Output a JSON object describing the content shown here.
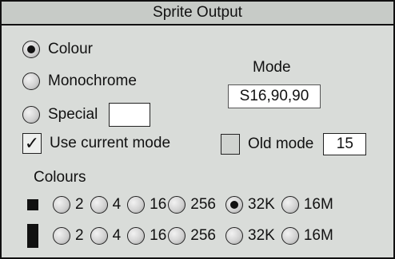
{
  "window": {
    "title": "Sprite Output"
  },
  "type_options": [
    {
      "label": "Colour",
      "selected": true
    },
    {
      "label": "Monochrome",
      "selected": false
    },
    {
      "label": "Special",
      "selected": false
    }
  ],
  "special_field": {
    "value": ""
  },
  "mode": {
    "label": "Mode",
    "value": "S16,90,90"
  },
  "use_current_mode": {
    "label": "Use current mode",
    "checked": true
  },
  "old_mode": {
    "label": "Old mode",
    "checked": false,
    "value": "15"
  },
  "colours": {
    "label": "Colours",
    "row1": [
      {
        "label": "2",
        "selected": false
      },
      {
        "label": "4",
        "selected": false
      },
      {
        "label": "16",
        "selected": false
      },
      {
        "label": "256",
        "selected": false
      },
      {
        "label": "32K",
        "selected": true
      },
      {
        "label": "16M",
        "selected": false
      }
    ],
    "row2": [
      {
        "label": "2",
        "selected": false
      },
      {
        "label": "4",
        "selected": false
      },
      {
        "label": "16",
        "selected": false
      },
      {
        "label": "256",
        "selected": false
      },
      {
        "label": "32K",
        "selected": false
      },
      {
        "label": "16M",
        "selected": false
      }
    ]
  },
  "icons": {
    "selected_radio": "radio-selected-icon",
    "unselected_radio": "radio-unselected-icon",
    "checkbox_tick": "✓"
  }
}
